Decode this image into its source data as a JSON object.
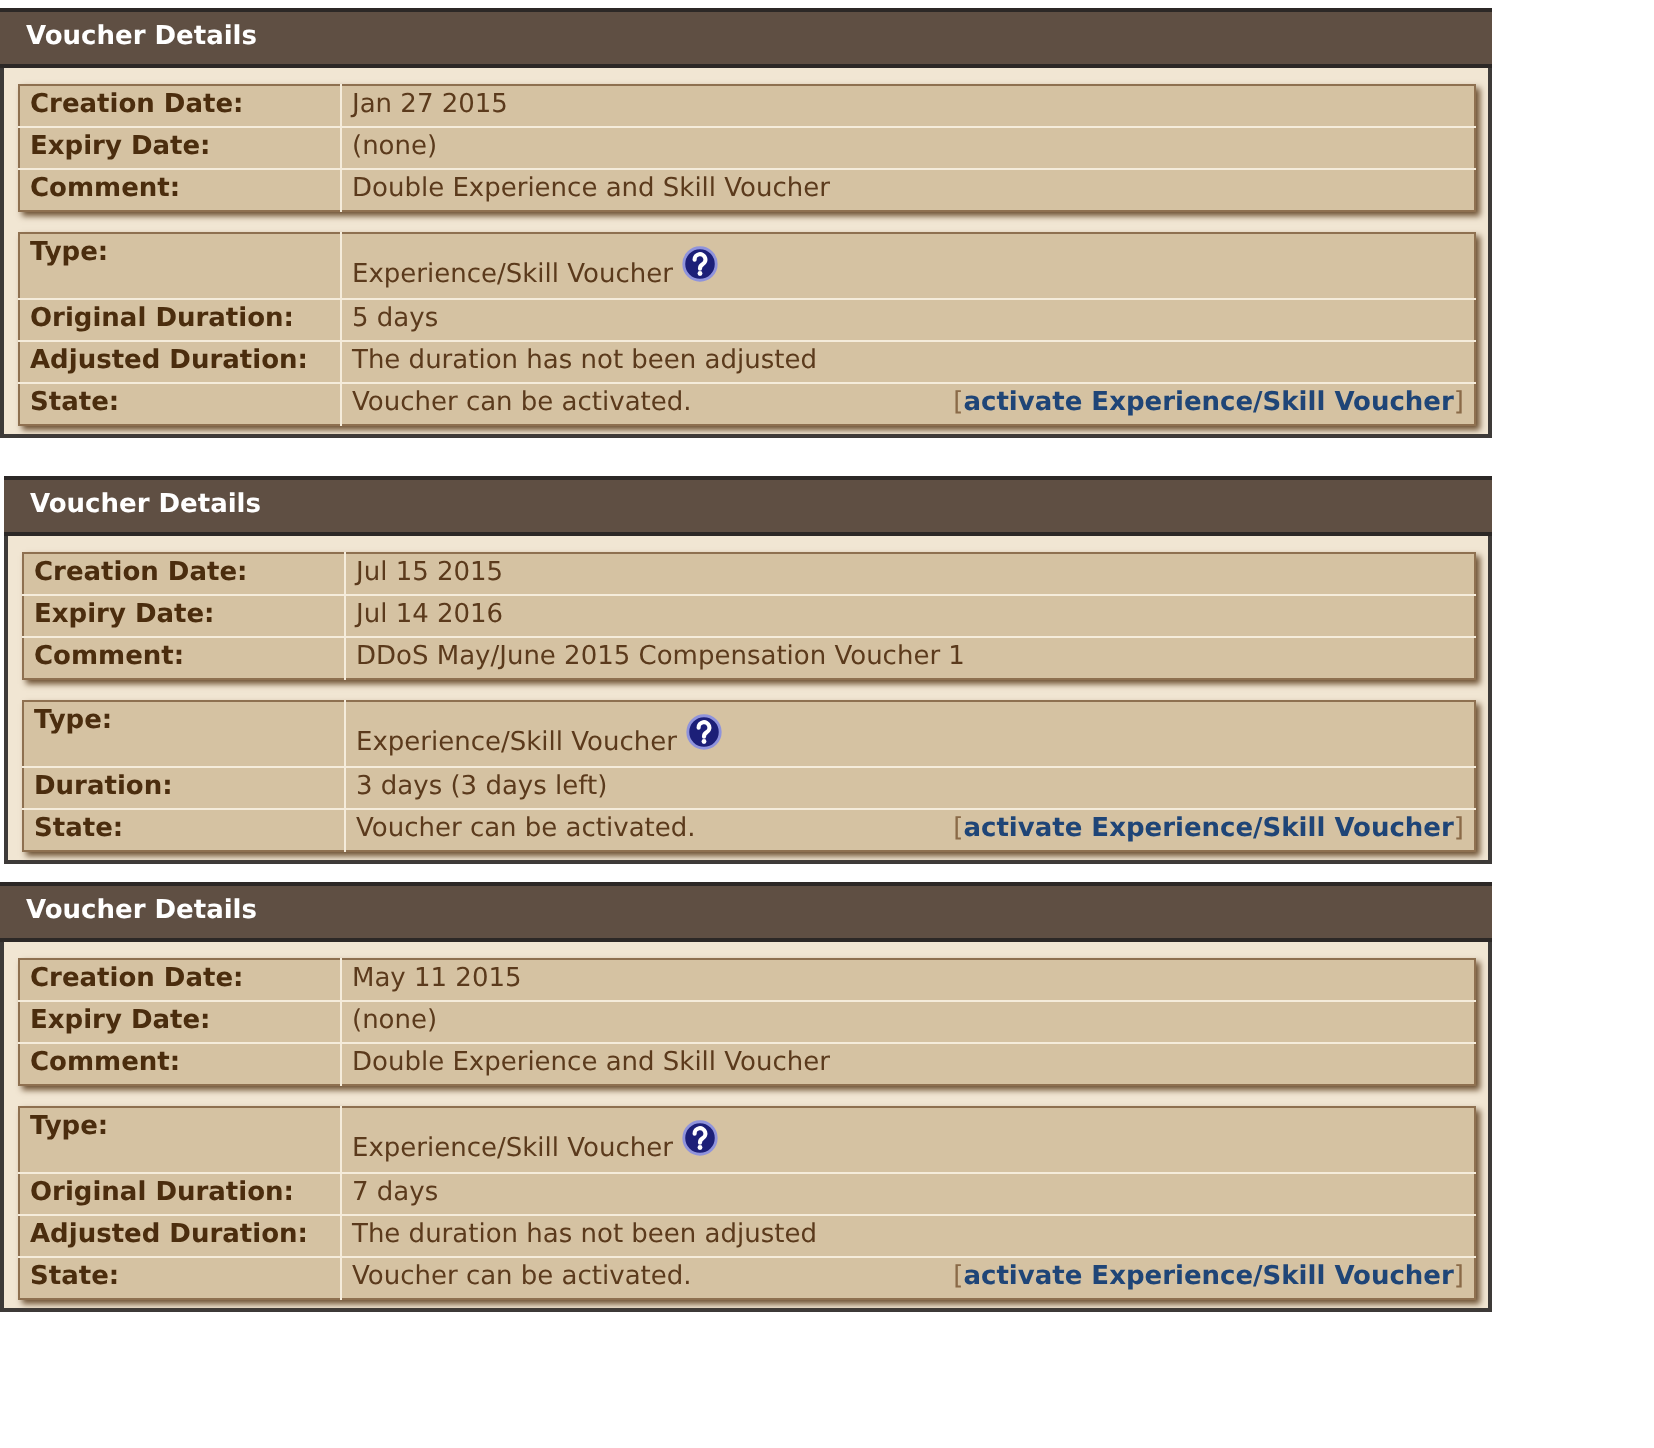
{
  "vouchers": [
    {
      "title": "Voucher Details",
      "details": [
        {
          "label": "Creation Date:",
          "value": "Jan 27 2015"
        },
        {
          "label": "Expiry Date:",
          "value": "(none)"
        },
        {
          "label": "Comment:",
          "value": "Double Experience and Skill Voucher"
        }
      ],
      "info": [
        {
          "kind": "help",
          "label": "Type:",
          "value": "Experience/Skill Voucher"
        },
        {
          "kind": "text",
          "label": "Original Duration:",
          "value": "5 days"
        },
        {
          "kind": "text",
          "label": "Adjusted Duration:",
          "value": "The duration has not been adjusted"
        },
        {
          "kind": "action",
          "label": "State:",
          "value": "Voucher can be activated.",
          "action": {
            "open": "[",
            "label": "activate Experience/Skill Voucher",
            "close": "]"
          }
        }
      ]
    },
    {
      "title": "Voucher Details",
      "details": [
        {
          "label": "Creation Date:",
          "value": "Jul 15 2015"
        },
        {
          "label": "Expiry Date:",
          "value": "Jul 14 2016"
        },
        {
          "label": "Comment:",
          "value": "DDoS May/June 2015 Compensation Voucher 1"
        }
      ],
      "info": [
        {
          "kind": "help",
          "label": "Type:",
          "value": "Experience/Skill Voucher"
        },
        {
          "kind": "text",
          "label": "Duration:",
          "value": "3 days (3 days left)"
        },
        {
          "kind": "action",
          "label": "State:",
          "value": "Voucher can be activated.",
          "action": {
            "open": "[",
            "label": "activate Experience/Skill Voucher",
            "close": "]"
          }
        }
      ]
    },
    {
      "title": "Voucher Details",
      "details": [
        {
          "label": "Creation Date:",
          "value": "May 11 2015"
        },
        {
          "label": "Expiry Date:",
          "value": "(none)"
        },
        {
          "label": "Comment:",
          "value": "Double Experience and Skill Voucher"
        }
      ],
      "info": [
        {
          "kind": "help",
          "label": "Type:",
          "value": "Experience/Skill Voucher"
        },
        {
          "kind": "text",
          "label": "Original Duration:",
          "value": "7 days"
        },
        {
          "kind": "text",
          "label": "Adjusted Duration:",
          "value": "The duration has not been adjusted"
        },
        {
          "kind": "action",
          "label": "State:",
          "value": "Voucher can be activated.",
          "action": {
            "open": "[",
            "label": "activate Experience/Skill Voucher",
            "close": "]"
          }
        }
      ]
    }
  ]
}
